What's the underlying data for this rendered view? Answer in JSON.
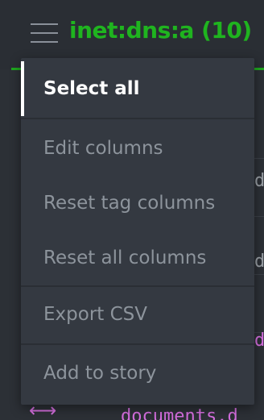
{
  "header": {
    "title": "inet:dns:a (10)",
    "menu_icon": "hamburger-menu-icon",
    "accent_color": "#1fb41f"
  },
  "background": {
    "fragments": [
      "d",
      "d",
      "d"
    ],
    "bottom_row_text": "documents.d",
    "link_icon": "link-arrows-icon"
  },
  "menu": {
    "items": [
      {
        "label": "Select all",
        "active": true
      },
      {
        "label": "Edit columns",
        "active": false
      },
      {
        "label": "Reset tag columns",
        "active": false
      },
      {
        "label": "Reset all columns",
        "active": false
      },
      {
        "label": "Export CSV",
        "active": false
      },
      {
        "label": "Add to story",
        "active": false
      }
    ]
  }
}
